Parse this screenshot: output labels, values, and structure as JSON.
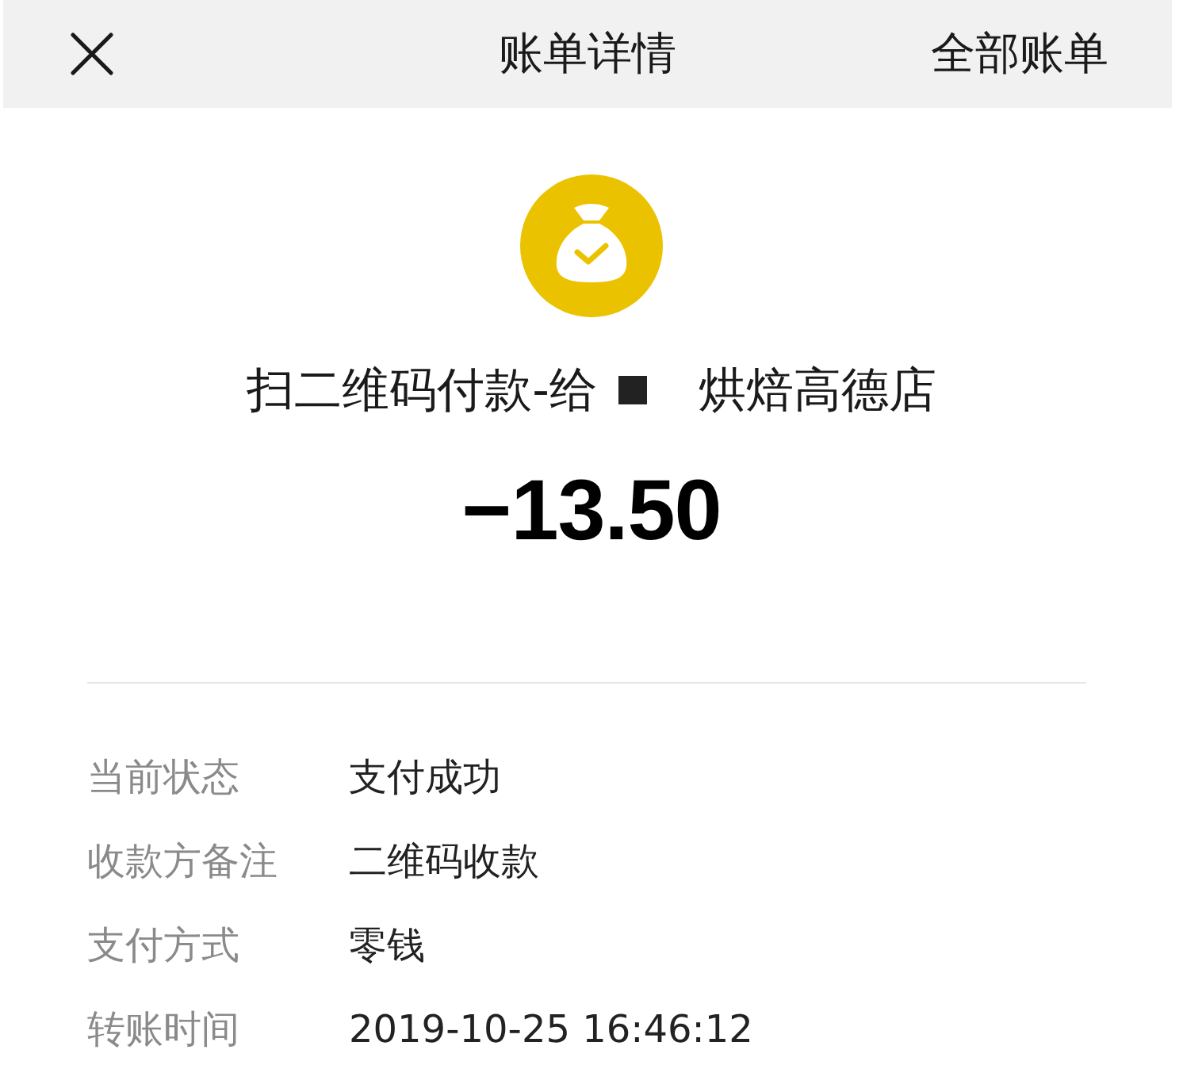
{
  "header": {
    "title": "账单详情",
    "action": "全部账单"
  },
  "transaction": {
    "title": {
      "prefix": "扫二维码付款-给",
      "redacted": true,
      "suffix": "烘焙高德店"
    },
    "amount": "−13.50"
  },
  "details": [
    {
      "label": "当前状态",
      "value": "支付成功"
    },
    {
      "label": "收款方备注",
      "value": "二维码收款"
    },
    {
      "label": "支付方式",
      "value": "零钱"
    },
    {
      "label": "转账时间",
      "value": "2019-10-25 16:46:12"
    }
  ]
}
